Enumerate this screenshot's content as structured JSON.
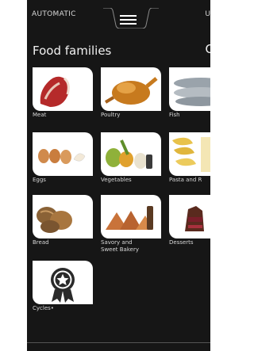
{
  "header": {
    "mode_label": "AUTOMATIC",
    "right_label": "U",
    "menu_icon": "hamburger-menu-icon"
  },
  "page": {
    "title": "Food families",
    "title_right_fragment": "C"
  },
  "tiles": [
    {
      "label": "Meat",
      "icon": "meat-icon"
    },
    {
      "label": "Poultry",
      "icon": "poultry-icon"
    },
    {
      "label": "Fish",
      "icon": "fish-icon"
    },
    {
      "label": "Eggs",
      "icon": "eggs-icon"
    },
    {
      "label": "Vegetables",
      "icon": "vegetables-icon"
    },
    {
      "label": "Pasta and R",
      "icon": "pasta-icon"
    },
    {
      "label": "Bread",
      "icon": "bread-icon"
    },
    {
      "label": "Savory and\nSweet Bakery",
      "icon": "bakery-icon"
    },
    {
      "label": "Desserts",
      "icon": "desserts-icon"
    },
    {
      "label": "Cycles•",
      "icon": "cycles-award-icon"
    }
  ],
  "colors": {
    "background": "#161616",
    "card": "#ffffff",
    "text": "#d8d8d8"
  }
}
